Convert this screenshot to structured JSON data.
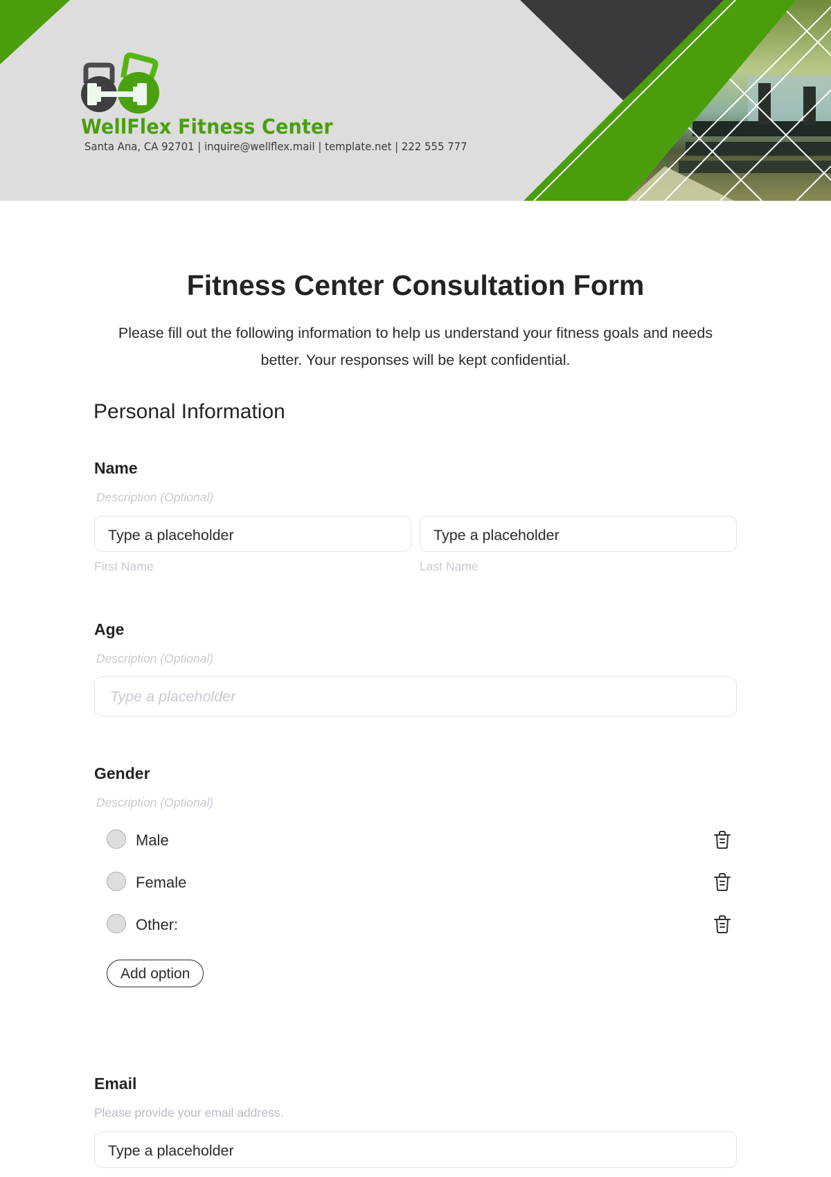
{
  "header": {
    "brand_name": "WellFlex Fitness Center",
    "contact_line": "Santa Ana, CA 92701 | inquire@wellflex.mail | template.net | 222 555 777",
    "logo_icon": "kettlebell-dumbbell-logo-icon",
    "colors": {
      "brand_green": "#4a9e0b",
      "dark_band": "#3a393c",
      "header_bg": "#dddddd"
    }
  },
  "form": {
    "title": "Fitness Center Consultation Form",
    "intro": "Please fill out the following information to help us understand your fitness goals and needs better. Your responses will be kept confidential.",
    "section_title": "Personal Information",
    "name": {
      "label": "Name",
      "description": "Description (Optional)",
      "first": {
        "value": "Type a placeholder",
        "sub_label": "First Name"
      },
      "last": {
        "value": "Type a placeholder",
        "sub_label": "Last Name"
      }
    },
    "age": {
      "label": "Age",
      "description": "Description (Optional)",
      "placeholder": "Type a placeholder"
    },
    "gender": {
      "label": "Gender",
      "description": "Description (Optional)",
      "options": [
        {
          "label": "Male",
          "selected": false
        },
        {
          "label": "Female",
          "selected": false
        },
        {
          "label": "Other:",
          "selected": false
        }
      ],
      "add_option_label": "Add option",
      "delete_icon": "trash-icon"
    },
    "email": {
      "label": "Email",
      "description": "Please provide your email address.",
      "value": "Type a placeholder"
    }
  }
}
